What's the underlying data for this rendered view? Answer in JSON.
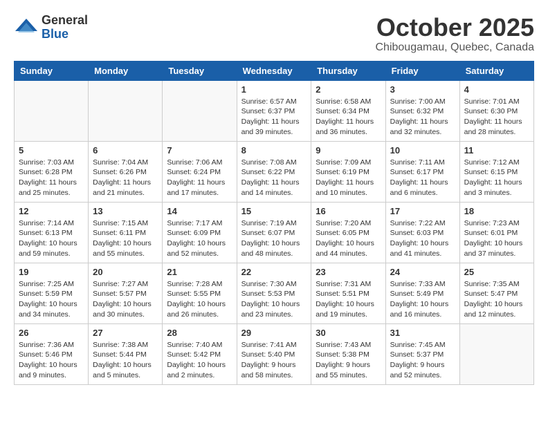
{
  "header": {
    "logo_general": "General",
    "logo_blue": "Blue",
    "month_year": "October 2025",
    "location": "Chibougamau, Quebec, Canada"
  },
  "weekdays": [
    "Sunday",
    "Monday",
    "Tuesday",
    "Wednesday",
    "Thursday",
    "Friday",
    "Saturday"
  ],
  "weeks": [
    [
      {
        "day": "",
        "info": ""
      },
      {
        "day": "",
        "info": ""
      },
      {
        "day": "",
        "info": ""
      },
      {
        "day": "1",
        "info": "Sunrise: 6:57 AM\nSunset: 6:37 PM\nDaylight: 11 hours\nand 39 minutes."
      },
      {
        "day": "2",
        "info": "Sunrise: 6:58 AM\nSunset: 6:34 PM\nDaylight: 11 hours\nand 36 minutes."
      },
      {
        "day": "3",
        "info": "Sunrise: 7:00 AM\nSunset: 6:32 PM\nDaylight: 11 hours\nand 32 minutes."
      },
      {
        "day": "4",
        "info": "Sunrise: 7:01 AM\nSunset: 6:30 PM\nDaylight: 11 hours\nand 28 minutes."
      }
    ],
    [
      {
        "day": "5",
        "info": "Sunrise: 7:03 AM\nSunset: 6:28 PM\nDaylight: 11 hours\nand 25 minutes."
      },
      {
        "day": "6",
        "info": "Sunrise: 7:04 AM\nSunset: 6:26 PM\nDaylight: 11 hours\nand 21 minutes."
      },
      {
        "day": "7",
        "info": "Sunrise: 7:06 AM\nSunset: 6:24 PM\nDaylight: 11 hours\nand 17 minutes."
      },
      {
        "day": "8",
        "info": "Sunrise: 7:08 AM\nSunset: 6:22 PM\nDaylight: 11 hours\nand 14 minutes."
      },
      {
        "day": "9",
        "info": "Sunrise: 7:09 AM\nSunset: 6:19 PM\nDaylight: 11 hours\nand 10 minutes."
      },
      {
        "day": "10",
        "info": "Sunrise: 7:11 AM\nSunset: 6:17 PM\nDaylight: 11 hours\nand 6 minutes."
      },
      {
        "day": "11",
        "info": "Sunrise: 7:12 AM\nSunset: 6:15 PM\nDaylight: 11 hours\nand 3 minutes."
      }
    ],
    [
      {
        "day": "12",
        "info": "Sunrise: 7:14 AM\nSunset: 6:13 PM\nDaylight: 10 hours\nand 59 minutes."
      },
      {
        "day": "13",
        "info": "Sunrise: 7:15 AM\nSunset: 6:11 PM\nDaylight: 10 hours\nand 55 minutes."
      },
      {
        "day": "14",
        "info": "Sunrise: 7:17 AM\nSunset: 6:09 PM\nDaylight: 10 hours\nand 52 minutes."
      },
      {
        "day": "15",
        "info": "Sunrise: 7:19 AM\nSunset: 6:07 PM\nDaylight: 10 hours\nand 48 minutes."
      },
      {
        "day": "16",
        "info": "Sunrise: 7:20 AM\nSunset: 6:05 PM\nDaylight: 10 hours\nand 44 minutes."
      },
      {
        "day": "17",
        "info": "Sunrise: 7:22 AM\nSunset: 6:03 PM\nDaylight: 10 hours\nand 41 minutes."
      },
      {
        "day": "18",
        "info": "Sunrise: 7:23 AM\nSunset: 6:01 PM\nDaylight: 10 hours\nand 37 minutes."
      }
    ],
    [
      {
        "day": "19",
        "info": "Sunrise: 7:25 AM\nSunset: 5:59 PM\nDaylight: 10 hours\nand 34 minutes."
      },
      {
        "day": "20",
        "info": "Sunrise: 7:27 AM\nSunset: 5:57 PM\nDaylight: 10 hours\nand 30 minutes."
      },
      {
        "day": "21",
        "info": "Sunrise: 7:28 AM\nSunset: 5:55 PM\nDaylight: 10 hours\nand 26 minutes."
      },
      {
        "day": "22",
        "info": "Sunrise: 7:30 AM\nSunset: 5:53 PM\nDaylight: 10 hours\nand 23 minutes."
      },
      {
        "day": "23",
        "info": "Sunrise: 7:31 AM\nSunset: 5:51 PM\nDaylight: 10 hours\nand 19 minutes."
      },
      {
        "day": "24",
        "info": "Sunrise: 7:33 AM\nSunset: 5:49 PM\nDaylight: 10 hours\nand 16 minutes."
      },
      {
        "day": "25",
        "info": "Sunrise: 7:35 AM\nSunset: 5:47 PM\nDaylight: 10 hours\nand 12 minutes."
      }
    ],
    [
      {
        "day": "26",
        "info": "Sunrise: 7:36 AM\nSunset: 5:46 PM\nDaylight: 10 hours\nand 9 minutes."
      },
      {
        "day": "27",
        "info": "Sunrise: 7:38 AM\nSunset: 5:44 PM\nDaylight: 10 hours\nand 5 minutes."
      },
      {
        "day": "28",
        "info": "Sunrise: 7:40 AM\nSunset: 5:42 PM\nDaylight: 10 hours\nand 2 minutes."
      },
      {
        "day": "29",
        "info": "Sunrise: 7:41 AM\nSunset: 5:40 PM\nDaylight: 9 hours\nand 58 minutes."
      },
      {
        "day": "30",
        "info": "Sunrise: 7:43 AM\nSunset: 5:38 PM\nDaylight: 9 hours\nand 55 minutes."
      },
      {
        "day": "31",
        "info": "Sunrise: 7:45 AM\nSunset: 5:37 PM\nDaylight: 9 hours\nand 52 minutes."
      },
      {
        "day": "",
        "info": ""
      }
    ]
  ]
}
